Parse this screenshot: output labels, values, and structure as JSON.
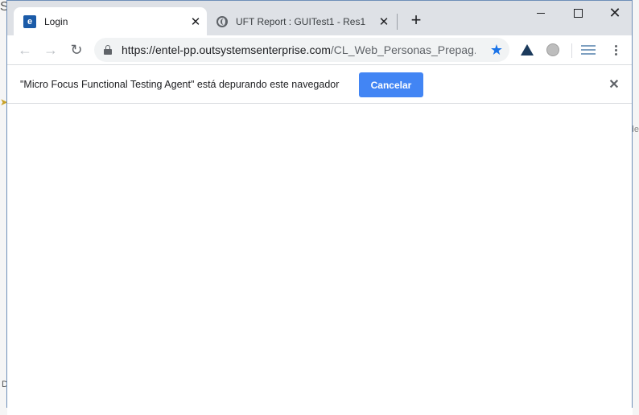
{
  "background": {
    "left_text_top": "S",
    "left_text_bottom": "D",
    "right_text": "de"
  },
  "tabs": [
    {
      "title": "Login",
      "favicon": "e-brand-icon",
      "active": true
    },
    {
      "title": "UFT Report : GUITest1 - Res1",
      "favicon": "globe-icon",
      "active": false
    }
  ],
  "toolbar": {
    "url_main": "https://entel-pp.outsystemsenterprise.com",
    "url_path": "/CL_Web_Personas_Prepag...",
    "extensions": [
      "triangle-logo-icon",
      "gray-circle-icon",
      "lines-icon"
    ]
  },
  "infobar": {
    "message": "\"Micro Focus Functional Testing Agent\" está depurando este navegador",
    "cancel_label": "Cancelar"
  },
  "colors": {
    "accent": "#4285f4",
    "tabstrip": "#dee1e6",
    "star": "#1a73e8"
  }
}
